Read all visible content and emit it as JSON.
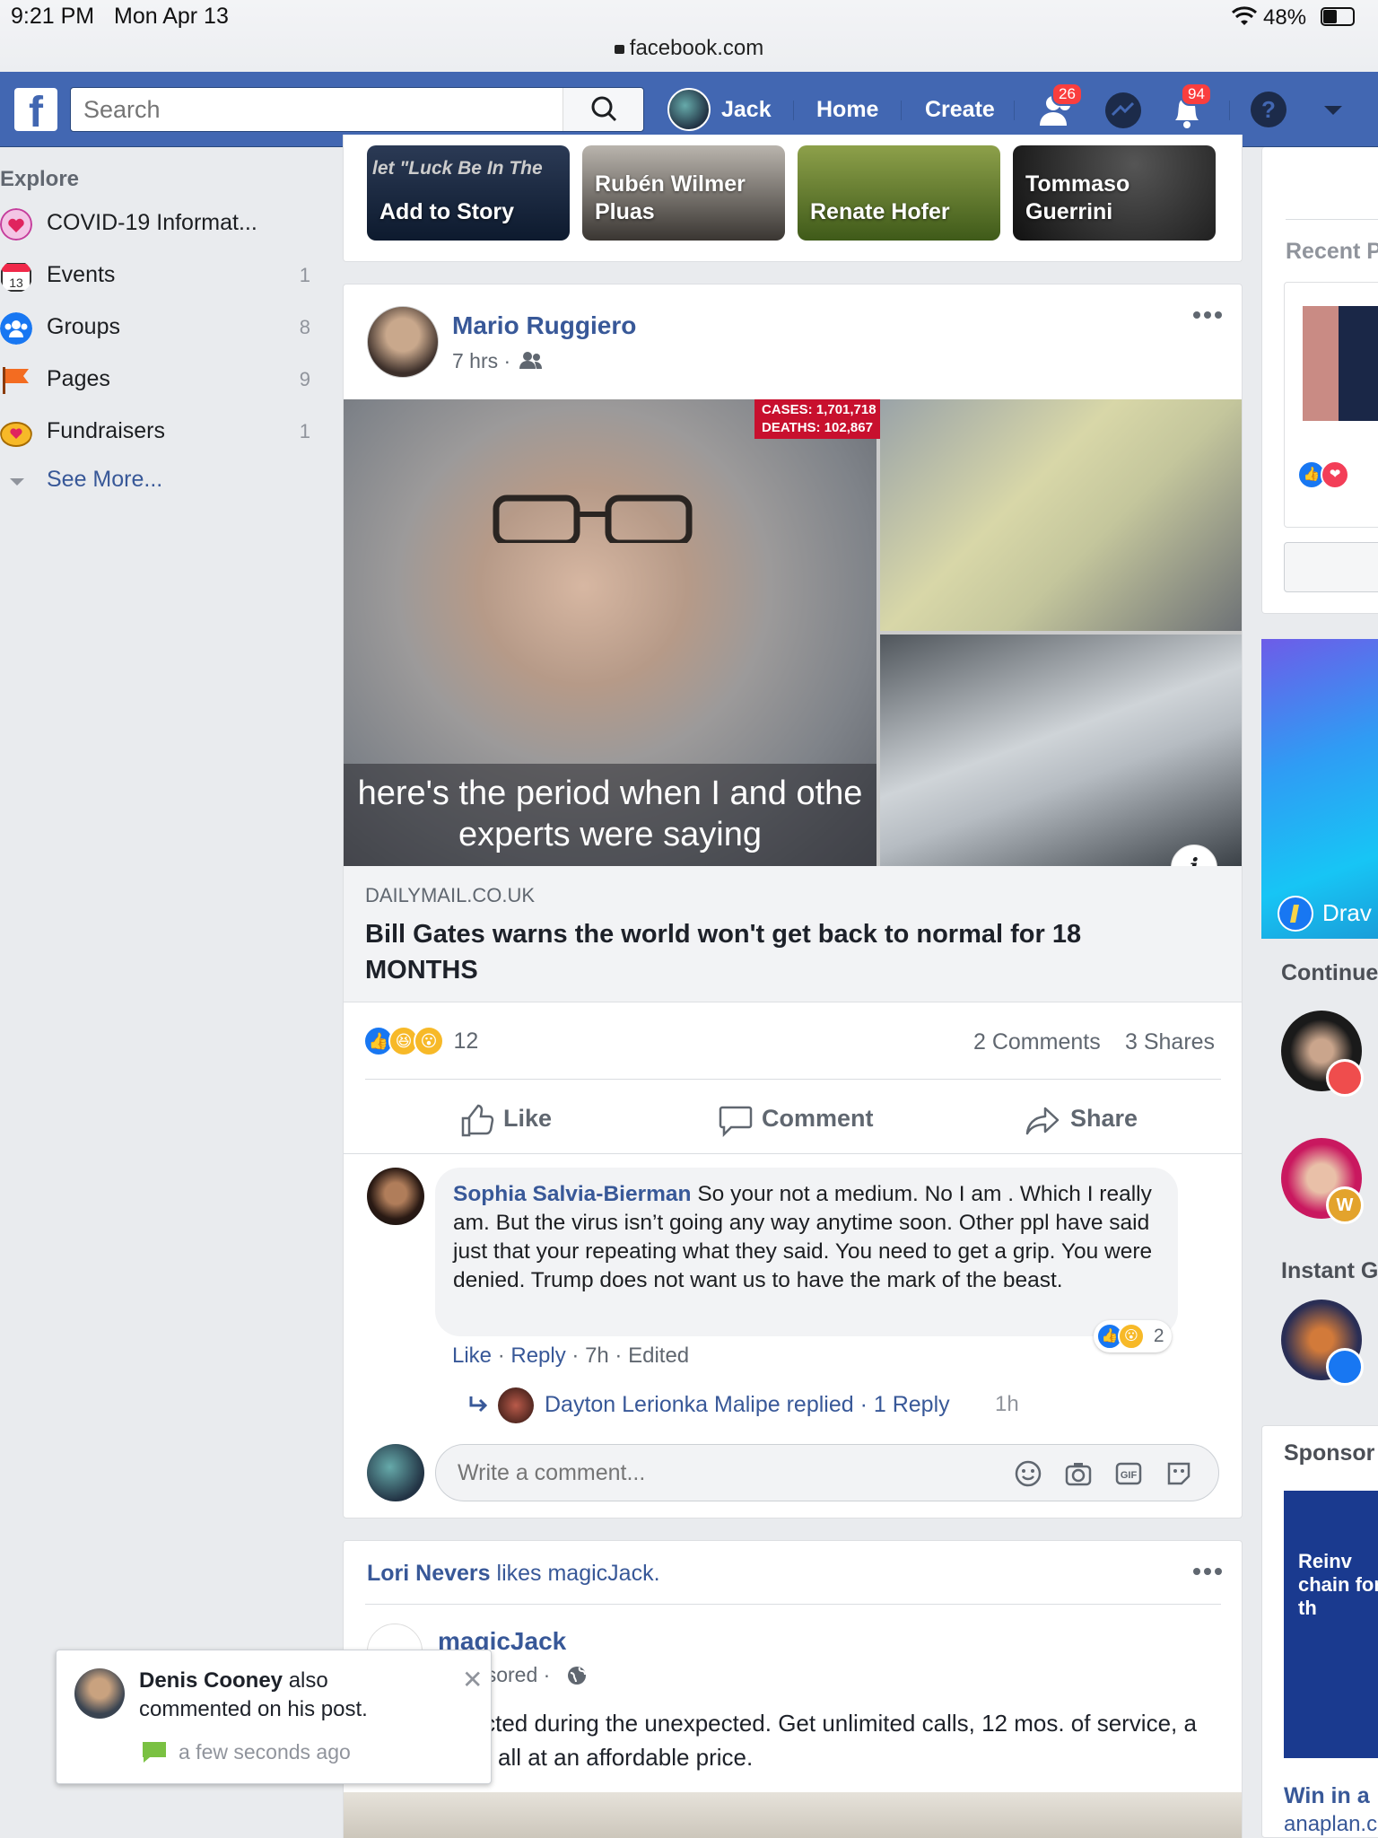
{
  "status_bar": {
    "time": "9:21 PM",
    "date": "Mon Apr 13",
    "url": "facebook.com",
    "battery": "48%"
  },
  "top_nav": {
    "logo": "f",
    "search_placeholder": "Search",
    "user": "Jack",
    "home": "Home",
    "create": "Create",
    "friend_requests_count": "26",
    "notifications_count": "94"
  },
  "left_nav": {
    "heading": "Explore",
    "items": [
      {
        "label": "COVID-19 Informat...",
        "count": "",
        "icon": "heart-shield-icon"
      },
      {
        "label": "Events",
        "count": "1",
        "icon": "calendar-icon"
      },
      {
        "label": "Groups",
        "count": "8",
        "icon": "groups-icon"
      },
      {
        "label": "Pages",
        "count": "9",
        "icon": "flag-icon"
      },
      {
        "label": "Fundraisers",
        "count": "1",
        "icon": "coin-icon"
      }
    ],
    "see_more": "See More..."
  },
  "stories": {
    "items": [
      {
        "label": "Add to Story",
        "overlay": "let \"Luck Be In The"
      },
      {
        "label": "Rubén Wilmer Pluas"
      },
      {
        "label": "Renate Hofer"
      },
      {
        "label": "Tommaso Guerrini"
      }
    ]
  },
  "post": {
    "author": "Mario Ruggiero",
    "time": "7 hrs ·",
    "image_caption_line1": "here's the period when I and othe",
    "image_caption_line2": "experts were saying",
    "cases_label": "CASES: 1,701,718",
    "deaths_label": "DEATHS: 102,867",
    "link_domain": "DAILYMAIL.CO.UK",
    "link_title": "Bill Gates warns the world won't get back to normal for 18 MONTHS",
    "reaction_count": "12",
    "comments_count": "2 Comments",
    "shares_count": "3 Shares",
    "actions": {
      "like": "Like",
      "comment": "Comment",
      "share": "Share"
    },
    "comment": {
      "author": "Sophia Salvia-Bierman",
      "text": "So your not a medium. No I am . Which I really am. But the virus isn’t going any way anytime soon. Other ppl have said just that your repeating what they said. You need to get a grip. You were denied. Trump does not want us to have the mark of the beast.",
      "like": "Like",
      "reply": "Reply",
      "meta": "· 7h · Edited",
      "reactions": "2"
    },
    "reply_line": {
      "text": "Dayton Lerionka Malipe replied · 1 Reply",
      "time": "1h"
    },
    "write_comment_placeholder": "Write a comment..."
  },
  "post2": {
    "liker": "Lori Nevers",
    "likes_text": "likes magicJack.",
    "page": "magicJack",
    "sponsored": "Sponsored ·",
    "body": "Stay connected during the unexpected. Get unlimited calls, 12 mos. of service, a second line, all at an affordable price."
  },
  "right_col": {
    "recent": "Recent P",
    "banner_label": "Drav",
    "continue": "Continue",
    "instant": "Instant G",
    "sponsored": "Sponsor",
    "ad_text": "Reinv chain for th",
    "ad_title": "Win in a",
    "ad_domain": "anaplan.c"
  },
  "notification": {
    "name": "Denis Cooney",
    "text": "also commented on his post.",
    "time": "a few seconds ago"
  },
  "colors": {
    "brand": "#4267b2",
    "link": "#385898",
    "badge": "#fa3e3e"
  }
}
